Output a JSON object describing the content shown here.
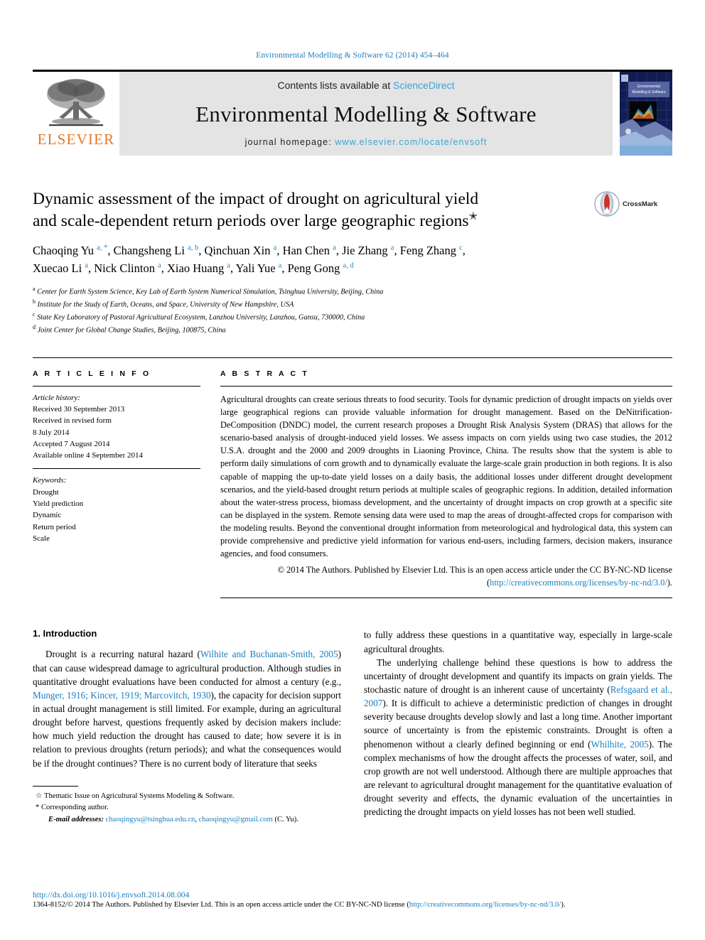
{
  "running_head": "Environmental Modelling & Software 62 (2014) 454–464",
  "masthead": {
    "publisher_name": "ELSEVIER",
    "contents_prefix": "Contents lists available at ",
    "contents_link": "ScienceDirect",
    "journal_title": "Environmental Modelling & Software",
    "homepage_prefix": "journal homepage: ",
    "homepage_url": "www.elsevier.com/locate/envsoft",
    "cover_title_line1": "Environmental",
    "cover_title_line2": "Modelling & Software"
  },
  "article": {
    "title_line1": "Dynamic assessment of the impact of drought on agricultural yield",
    "title_line2": "and scale-dependent return periods over large geographic regions",
    "title_footnote_marker": "✭",
    "crossmark_label": "CrossMark",
    "authors": [
      {
        "name": "Chaoqing Yu",
        "sup": "a, *"
      },
      {
        "name": "Changsheng Li",
        "sup": "a, b"
      },
      {
        "name": "Qinchuan Xin",
        "sup": "a"
      },
      {
        "name": "Han Chen",
        "sup": "a"
      },
      {
        "name": "Jie Zhang",
        "sup": "a"
      },
      {
        "name": "Feng Zhang",
        "sup": "c"
      },
      {
        "name": "Xuecao Li",
        "sup": "a"
      },
      {
        "name": "Nick Clinton",
        "sup": "a"
      },
      {
        "name": "Xiao Huang",
        "sup": "a"
      },
      {
        "name": "Yali Yue",
        "sup": "a"
      },
      {
        "name": "Peng Gong",
        "sup": "a, d"
      }
    ],
    "affiliations": [
      {
        "marker": "a",
        "text": "Center for Earth System Science, Key Lab of Earth System Numerical Simulation, Tsinghua University, Beijing, China"
      },
      {
        "marker": "b",
        "text": "Institute for the Study of Earth, Oceans, and Space, University of New Hampshire, USA"
      },
      {
        "marker": "c",
        "text": "State Key Laboratory of Pastoral Agricultural Ecosystem, Lanzhou University, Lanzhou, Gansu, 730000, China"
      },
      {
        "marker": "d",
        "text": "Joint Center for Global Change Studies, Beijing, 100875, China"
      }
    ]
  },
  "article_info": {
    "heading": "A R T I C L E   I N F O",
    "history_label": "Article history:",
    "history_lines": [
      "Received 30 September 2013",
      "Received in revised form",
      "8 July 2014",
      "Accepted 7 August 2014",
      "Available online 4 September 2014"
    ],
    "keywords_label": "Keywords:",
    "keywords": [
      "Drought",
      "Yield prediction",
      "Dynamic",
      "Return period",
      "Scale"
    ]
  },
  "abstract": {
    "heading": "A B S T R A C T",
    "text": "Agricultural droughts can create serious threats to food security. Tools for dynamic prediction of drought impacts on yields over large geographical regions can provide valuable information for drought management. Based on the DeNitrification-DeComposition (DNDC) model, the current research proposes a Drought Risk Analysis System (DRAS) that allows for the scenario-based analysis of drought-induced yield losses. We assess impacts on corn yields using two case studies, the 2012 U.S.A. drought and the 2000 and 2009 droughts in Liaoning Province, China. The results show that the system is able to perform daily simulations of corn growth and to dynamically evaluate the large-scale grain production in both regions. It is also capable of mapping the up-to-date yield losses on a daily basis, the additional losses under different drought development scenarios, and the yield-based drought return periods at multiple scales of geographic regions. In addition, detailed information about the water-stress process, biomass development, and the uncertainty of drought impacts on crop growth at a specific site can be displayed in the system. Remote sensing data were used to map the areas of drought-affected crops for comparison with the modeling results. Beyond the conventional drought information from meteorological and hydrological data, this system can provide comprehensive and predictive yield information for various end-users, including farmers, decision makers, insurance agencies, and food consumers.",
    "copyright_text": "© 2014 The Authors. Published by Elsevier Ltd. This is an open access article under the CC BY-NC-ND license (",
    "copyright_url": "http://creativecommons.org/licenses/by-nc-nd/3.0/",
    "copyright_tail": ")."
  },
  "introduction": {
    "section_title": "1.  Introduction",
    "left_par1_a": "Drought is a recurring natural hazard (",
    "left_cite1": "Wilhite and Buchanan-Smith, 2005",
    "left_par1_b": ") that can cause widespread damage to agricultural production. Although studies in quantitative drought evaluations have been conducted for almost a century (e.g., ",
    "left_cite2": "Munger, 1916; Kincer, 1919; Marcovitch, 1930",
    "left_par1_c": "), the capacity for decision support in actual drought management is still limited. For example, during an agricultural drought before harvest, questions frequently asked by decision makers include: how much yield reduction the drought has caused to date; how severe it is in relation to previous droughts (return periods); and what the consequences would be if the drought continues? There is no current body of literature that seeks",
    "right_par1_cont": "to fully address these questions in a quantitative way, especially in large-scale agricultural droughts.",
    "right_par2_a": "The underlying challenge behind these questions is how to address the uncertainty of drought development and quantify its impacts on grain yields. The stochastic nature of drought is an inherent cause of uncertainty (",
    "right_cite1": "Refsgaard et al., 2007",
    "right_par2_b": "). It is difficult to achieve a deterministic prediction of changes in drought severity because droughts develop slowly and last a long time. Another important source of uncertainty is from the epistemic constraints. Drought is often a phenomenon without a clearly defined beginning or end (",
    "right_cite2": "Whilhite, 2005",
    "right_par2_c": "). The complex mechanisms of how the drought affects the processes of water, soil, and crop growth are not well understood. Although there are multiple approaches that are relevant to agricultural drought management for the quantitative evaluation of drought severity and effects, the dynamic evaluation of the uncertainties in predicting the drought impacts on yield losses has not been well studied."
  },
  "footnotes": {
    "star_marker": "☆",
    "star_text": "Thematic Issue on Agricultural Systems Modeling & Software.",
    "corresponding_marker": "*",
    "corresponding_text": "Corresponding author.",
    "email_label": "E-mail addresses:",
    "email1": "chaoqingyu@tsinghua.edu.cn",
    "email_sep": ", ",
    "email2": "chaoqingyu@gmail.com",
    "email_tail": " (C. Yu)."
  },
  "page_footer": {
    "doi": "http://dx.doi.org/10.1016/j.envsoft.2014.08.004",
    "issn_prefix": "1364-8152/© 2014 The Authors. Published by Elsevier Ltd. This is an open access article under the CC BY-NC-ND license (",
    "issn_url": "http://creativecommons.org/licenses/by-nc-nd/3.0/",
    "issn_tail": ")."
  },
  "colors": {
    "link_blue": "#1a7fbf",
    "sciencedirect_blue": "#3aa3d6",
    "elsevier_orange": "#E87722",
    "masthead_gray": "#e4e4e4"
  }
}
